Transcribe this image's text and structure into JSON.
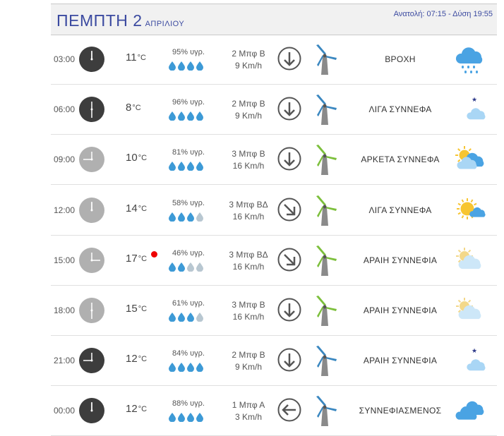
{
  "header": {
    "day": "ΠΕΜΠΤΗ 2",
    "month": "ΑΠΡΙΛΙΟΥ",
    "sun": "Ανατολή: 07:15 - Δύση 19:55"
  },
  "rows": [
    {
      "time": "03:00",
      "clock": "dark",
      "hand": "0",
      "temp": "11",
      "hum": "95% υγρ.",
      "drops": 4,
      "wind_bf": "2 Μπφ Β",
      "wind_kmh": "9 Km/h",
      "arrow": "down",
      "turbine_blade": "#3a87c0",
      "cond": "ΒΡΟΧΗ",
      "icon": "rain-cloud-icon"
    },
    {
      "time": "06:00",
      "clock": "dark",
      "hand": "180",
      "temp": "8",
      "hum": "96% υγρ.",
      "drops": 4,
      "wind_bf": "2 Μπφ Β",
      "wind_kmh": "9 Km/h",
      "arrow": "down",
      "turbine_blade": "#3a87c0",
      "cond": "ΛΙΓΑ ΣΥΝΝΕΦΑ",
      "icon": "moon-cloud-icon"
    },
    {
      "time": "09:00",
      "clock": "light",
      "hand": "270",
      "temp": "10",
      "hum": "81% υγρ.",
      "drops": 4,
      "wind_bf": "3 Μπφ Β",
      "wind_kmh": "16 Km/h",
      "arrow": "down",
      "turbine_blade": "#7cbf3b",
      "cond": "ΑΡΚΕΤΑ ΣΥΝΝΕΦΑ",
      "icon": "sun-clouds-icon"
    },
    {
      "time": "12:00",
      "clock": "light",
      "hand": "0",
      "temp": "14",
      "hum": "58% υγρ.",
      "drops": 3,
      "wind_bf": "3 Μπφ ΒΔ",
      "wind_kmh": "16 Km/h",
      "arrow": "down-right",
      "turbine_blade": "#7cbf3b",
      "cond": "ΛΙΓΑ ΣΥΝΝΕΦΑ",
      "icon": "sun-small-cloud-icon"
    },
    {
      "time": "15:00",
      "clock": "light",
      "hand": "90",
      "temp": "17",
      "hot": true,
      "hum": "46% υγρ.",
      "drops": 2,
      "wind_bf": "3 Μπφ ΒΔ",
      "wind_kmh": "16 Km/h",
      "arrow": "down-right",
      "turbine_blade": "#7cbf3b",
      "cond": "ΑΡΑΙΗ ΣΥΝΝΕΦΙΑ",
      "icon": "faded-sun-cloud-icon"
    },
    {
      "time": "18:00",
      "clock": "light",
      "hand": "180",
      "temp": "15",
      "hum": "61% υγρ.",
      "drops": 3,
      "wind_bf": "3 Μπφ Β",
      "wind_kmh": "16 Km/h",
      "arrow": "down",
      "turbine_blade": "#7cbf3b",
      "cond": "ΑΡΑΙΗ ΣΥΝΝΕΦΙΑ",
      "icon": "faded-sun-cloud-icon"
    },
    {
      "time": "21:00",
      "clock": "dark",
      "hand": "270",
      "temp": "12",
      "hum": "84% υγρ.",
      "drops": 4,
      "wind_bf": "2 Μπφ Β",
      "wind_kmh": "9 Km/h",
      "arrow": "down",
      "turbine_blade": "#3a87c0",
      "cond": "ΑΡΑΙΗ ΣΥΝΝΕΦΙΑ",
      "icon": "moon-cloud-icon"
    },
    {
      "time": "00:00",
      "clock": "dark",
      "hand": "0",
      "temp": "12",
      "hum": "88% υγρ.",
      "drops": 4,
      "wind_bf": "1 Μπφ Α",
      "wind_kmh": "3 Km/h",
      "arrow": "left",
      "turbine_blade": "#3a87c0",
      "cond": "ΣΥΝΝΕΦΙΑΣΜΕΝΟΣ",
      "icon": "clouds-icon"
    }
  ],
  "colors": {
    "title": "#3b4aa0",
    "drop_full": "#3d9ad6",
    "drop_empty": "#b8c7d1",
    "hot_dot": "#e00000"
  }
}
